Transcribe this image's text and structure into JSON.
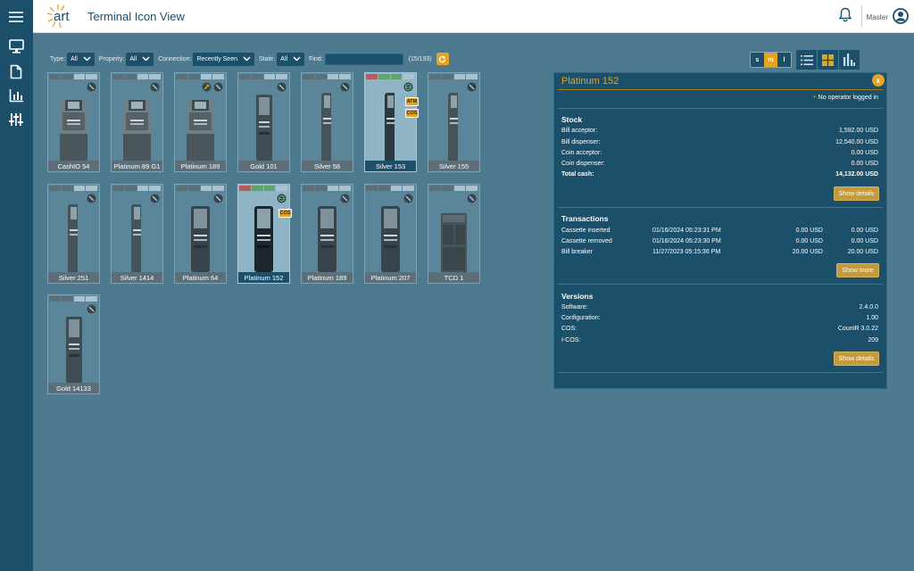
{
  "header": {
    "logo_text": "art",
    "title": "Terminal Icon View",
    "user_name": "Master"
  },
  "sidebar": {
    "items": [
      "menu-icon",
      "monitor-icon",
      "document-icon",
      "bar-chart-icon",
      "sliders-icon"
    ]
  },
  "filters": {
    "type_label": "Type:",
    "type_value": "All",
    "property_label": "Property:",
    "property_value": "All",
    "connection_label": "Connection:",
    "connection_value": "Recently Seen",
    "state_label": "State:",
    "state_value": "All",
    "find_label": "Find:",
    "find_value": "",
    "count": "(15/193)"
  },
  "view_controls": {
    "sizes": [
      "s",
      "m",
      "l"
    ],
    "active_size": "m"
  },
  "terminals": [
    {
      "name": "CashIO 54"
    },
    {
      "name": "Platinum 89 G1"
    },
    {
      "name": "Platinum 189"
    },
    {
      "name": "Gold 101"
    },
    {
      "name": "Silver 58"
    },
    {
      "name": "Silver 153",
      "badges": [
        "ATM",
        "COS"
      ]
    },
    {
      "name": "Silver 155"
    },
    {
      "name": "Silver 251"
    },
    {
      "name": "Silver 1414"
    },
    {
      "name": "Platinum 64"
    },
    {
      "name": "Platinum 152",
      "badges": [
        "COS"
      ]
    },
    {
      "name": "Platinum 189"
    },
    {
      "name": "Platinum 207"
    },
    {
      "name": "TCD 1"
    },
    {
      "name": "Gold 14133"
    }
  ],
  "detail": {
    "title": "Platinum 152",
    "close_label": "x",
    "operator_status": "No operator logged in",
    "stock": {
      "title": "Stock",
      "rows": [
        {
          "label": "Bill acceptor:",
          "value": "1,592.00 USD"
        },
        {
          "label": "Bill dispenser:",
          "value": "12,540.00 USD"
        },
        {
          "label": "Coin acceptor:",
          "value": "0.00 USD"
        },
        {
          "label": "Coin dispenser:",
          "value": "0.00 USD"
        },
        {
          "label": "Total cash:",
          "value": "14,132.00 USD"
        }
      ],
      "button": "Show details"
    },
    "transactions": {
      "title": "Transactions",
      "rows": [
        {
          "type": "Cassette inserted",
          "date": "01/16/2024 05:23:31 PM",
          "amount1": "0.00 USD",
          "amount2": "0.00 USD"
        },
        {
          "type": "Cassette removed",
          "date": "01/16/2024 05:23:30 PM",
          "amount1": "0.00 USD",
          "amount2": "0.00 USD"
        },
        {
          "type": "Bill breaker",
          "date": "11/27/2023 05:15:36 PM",
          "amount1": "20.00 USD",
          "amount2": "20.00 USD"
        }
      ],
      "button": "Show more"
    },
    "versions": {
      "title": "Versions",
      "rows": [
        {
          "label": "Software:",
          "value": "2.4.0.0"
        },
        {
          "label": "Configuration:",
          "value": "1.00"
        },
        {
          "label": "COS:",
          "value": "CountR 3.0.22"
        },
        {
          "label": "I-COS:",
          "value": "209"
        }
      ],
      "button": "Show details"
    }
  },
  "colors": {
    "primary": "#1b4f6a",
    "accent": "#e3a324",
    "background": "#4d7a8f"
  }
}
